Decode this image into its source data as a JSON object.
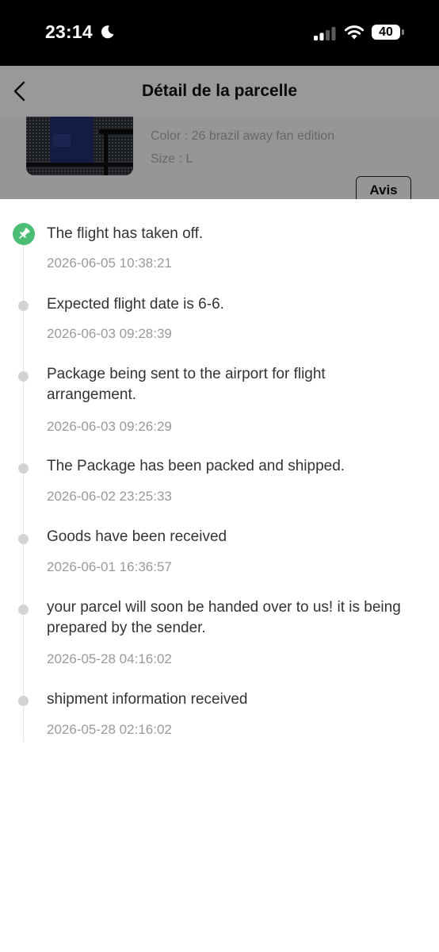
{
  "status_bar": {
    "time": "23:14",
    "battery": "40"
  },
  "header": {
    "title": "Détail de la parcelle"
  },
  "product": {
    "color": "Color : 26 brazil away fan edition",
    "size": "Size : L",
    "review_label": "Avis"
  },
  "colors": {
    "active": "#4cbd74",
    "inactive_dot": "#d3d3d3",
    "text": "#333333",
    "time_text": "#9a9a9a"
  },
  "tracking": {
    "events": [
      {
        "text": "The flight has taken off.",
        "time": "2026-06-05 10:38:21",
        "active": true,
        "icon": "pin-icon"
      },
      {
        "text": "Expected flight date is 6-6.",
        "time": "2026-06-03 09:28:39"
      },
      {
        "text": "Package being sent to the airport for flight arrangement.",
        "time": "2026-06-03 09:26:29"
      },
      {
        "text": "The Package has been packed and shipped.",
        "time": "2026-06-02 23:25:33"
      },
      {
        "text": "Goods have been received",
        "time": "2026-06-01 16:36:57"
      },
      {
        "text": "your parcel will soon be handed over to us! it is being prepared by the sender.",
        "time": "2026-05-28 04:16:02"
      },
      {
        "text": "shipment information received",
        "time": "2026-05-28 02:16:02"
      }
    ]
  }
}
